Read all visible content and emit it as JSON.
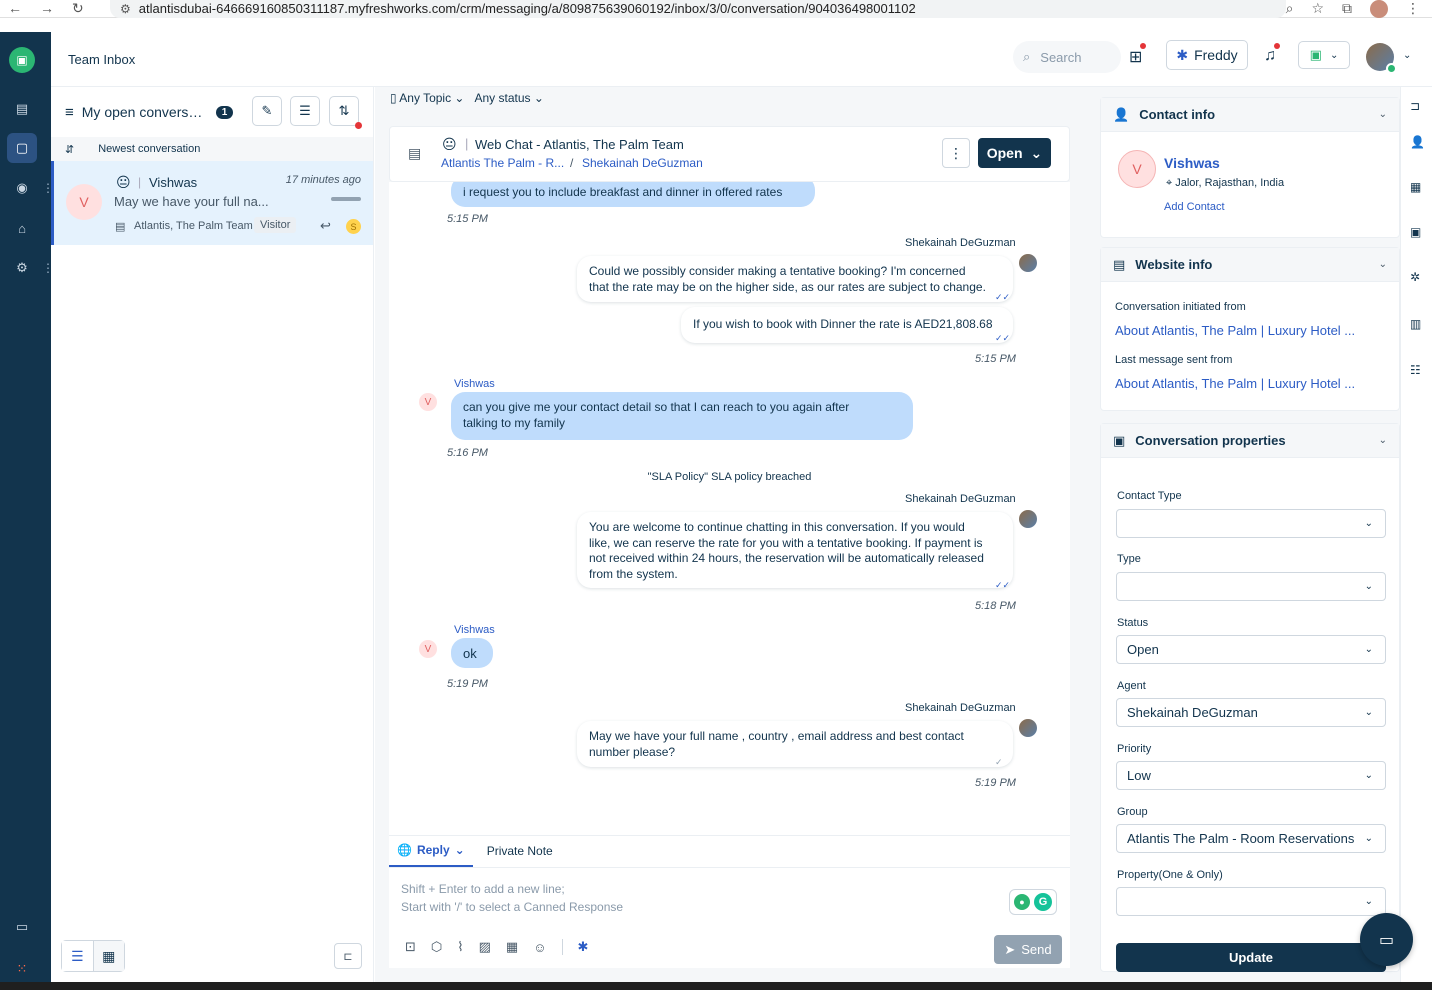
{
  "browser": {
    "url": "atlantisdubai-646669160850311187.myfreshworks.com/crm/messaging/a/809875639060192/inbox/3/0/conversation/904036498001102"
  },
  "header": {
    "title": "Team Inbox",
    "search_placeholder": "Search",
    "freddy_label": "Freddy"
  },
  "list": {
    "view_name": "My open conversatio...",
    "count": "1",
    "sort_label": "Newest conversation",
    "item": {
      "avatar": "V",
      "name": "Vishwas",
      "time": "17 minutes ago",
      "preview": "May we have your full na...",
      "team": "Atlantis, The Palm Team",
      "tag": "Visitor",
      "coin": "S"
    }
  },
  "filters": {
    "topic": "Any Topic",
    "status": "Any status"
  },
  "conversation": {
    "channel": "Web Chat - Atlantis, The Palm Team",
    "crumb_group": "Atlantis The Palm - R...",
    "crumb_sep": "/",
    "crumb_agent": "Shekainah DeGuzman",
    "status_button": "Open",
    "messages": {
      "m1": {
        "text": "i request you to include breakfast and dinner in offered rates",
        "time": "5:15 PM"
      },
      "m2": {
        "sender": "Shekainah DeGuzman",
        "line1": "Could we possibly consider making a tentative booking? I'm concerned",
        "line2": "that the rate may be on the higher side, as our rates are subject to change."
      },
      "m3": {
        "text": "If you wish to book with Dinner the rate is AED21,808.68",
        "time": "5:15 PM"
      },
      "m4": {
        "sender": "Vishwas",
        "line1": "can you give me your contact detail so that I can reach to you again after",
        "line2": "talking to my family",
        "time": "5:16 PM"
      },
      "sys": "\"SLA Policy\" SLA policy breached",
      "m5": {
        "sender": "Shekainah DeGuzman",
        "line1": "You are welcome to continue chatting in this conversation. If you would",
        "line2": "like, we can reserve the rate for you with a tentative booking. If payment is",
        "line3": "not received within 24 hours, the reservation will be automatically released",
        "line4": "from the system.",
        "time": "5:18 PM"
      },
      "m6": {
        "sender": "Vishwas",
        "text": "ok",
        "time": "5:19 PM"
      },
      "m7": {
        "sender": "Shekainah DeGuzman",
        "line1": "May we have your full name , country , email address and best contact",
        "line2": "number please?",
        "time": "5:19 PM"
      },
      "cust_initial": "V"
    }
  },
  "composer": {
    "reply_tab": "Reply",
    "note_tab": "Private Note",
    "placeholder1": "Shift + Enter to add a new line;",
    "placeholder2": "Start with '/' to select a Canned Response",
    "send_label": "Send"
  },
  "contact_info": {
    "heading": "Contact info",
    "avatar": "V",
    "name": "Vishwas",
    "location": "Jalor, Rajasthan, India",
    "add_contact": "Add Contact"
  },
  "website_info": {
    "heading": "Website info",
    "initiated_label": "Conversation initiated from",
    "initiated_link": "About Atlantis, The Palm | Luxury Hotel ...",
    "last_label": "Last message sent from",
    "last_link": "About Atlantis, The Palm | Luxury Hotel ..."
  },
  "properties": {
    "heading": "Conversation properties",
    "contact_type_label": "Contact Type",
    "contact_type_value": "",
    "type_label": "Type",
    "type_value": "",
    "status_label": "Status",
    "status_value": "Open",
    "agent_label": "Agent",
    "agent_value": "Shekainah DeGuzman",
    "priority_label": "Priority",
    "priority_value": "Low",
    "group_label": "Group",
    "group_value": "Atlantis The Palm - Room Reservations",
    "property_label": "Property(One & Only)",
    "property_value": "",
    "update_label": "Update"
  },
  "colors": {
    "brand_dark": "#12344d",
    "link_blue": "#2c5cc5",
    "customer_bubble": "#bfdcfc",
    "online_green": "#2bb673"
  }
}
